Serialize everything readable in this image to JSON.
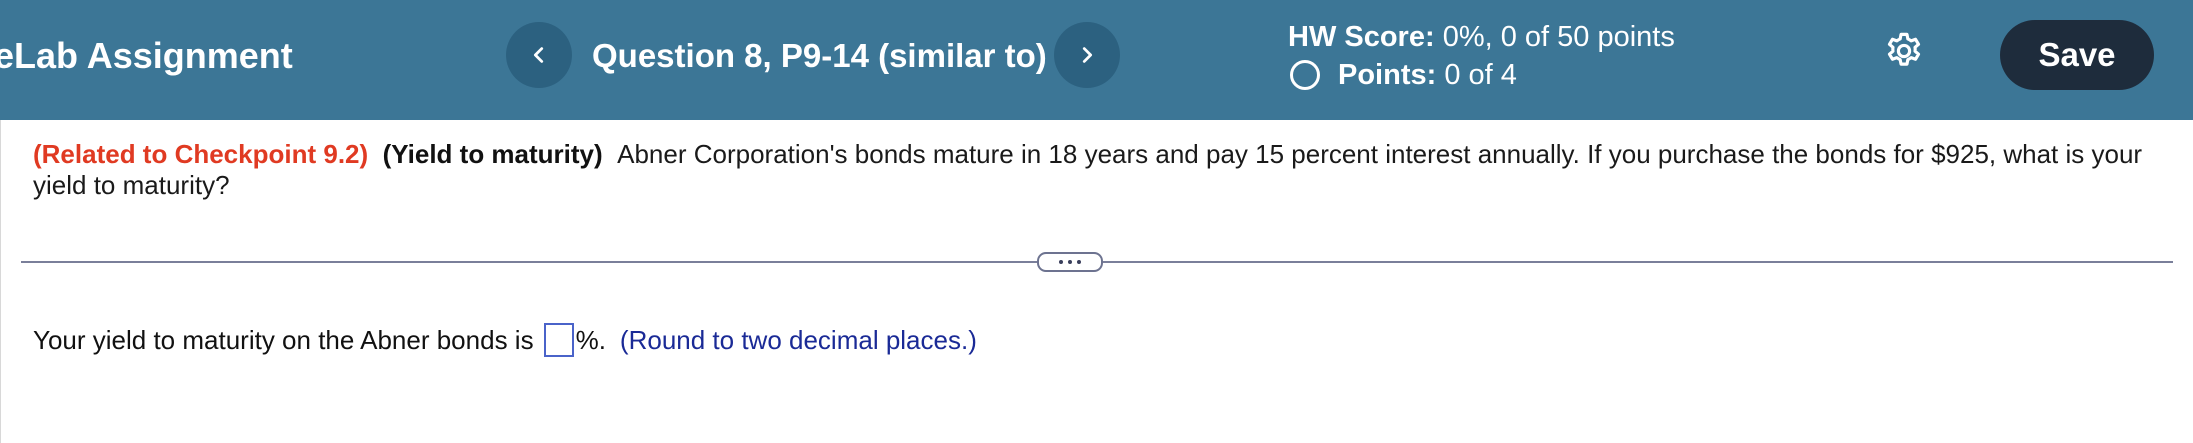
{
  "header": {
    "app_title": "eLab Assignment",
    "question_title": "Question 8, P9-14 (similar to)",
    "hw_score_label": "HW Score:",
    "hw_score_value": "0%, 0 of 50 points",
    "points_label": "Points:",
    "points_value": "0 of 4",
    "save_label": "Save",
    "prev_icon": "chevron-left-icon",
    "next_icon": "chevron-right-icon",
    "settings_icon": "gear-icon"
  },
  "question": {
    "related": "(Related to Checkpoint 9.2)",
    "topic": "(Yield to maturity)",
    "body": "Abner Corporation's bonds mature in 18 years and pay 15 percent interest annually.  If you purchase the bonds for $925, what is your yield to maturity?"
  },
  "answer": {
    "prompt": "Your yield to maturity on the Abner bonds is",
    "value": "",
    "unit": "%.",
    "hint": "(Round to two decimal places.)"
  },
  "colors": {
    "header_bg": "#3c7696",
    "nav_button_bg": "#2c6180",
    "save_button_bg": "#1e2c3c",
    "related_text": "#e03a22",
    "hint_text": "#1a2a96",
    "input_border": "#4a63c9"
  }
}
